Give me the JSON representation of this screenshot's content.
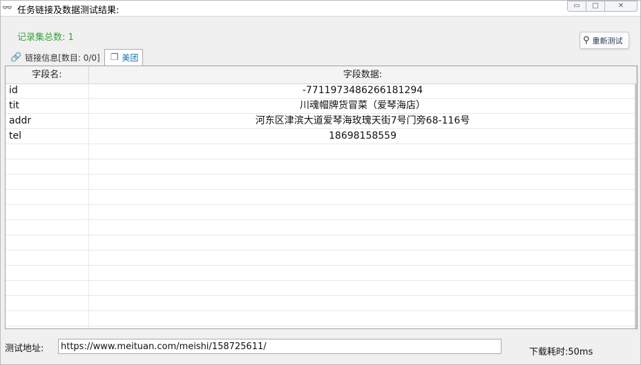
{
  "titlebar": {
    "title": "任务链接及数据测试结果:",
    "app_icon": "glasses-icon",
    "minimize_symbol": "▭",
    "restore_symbol": "□",
    "close_symbol": "✕"
  },
  "summary": {
    "record_count": "记录集总数: 1"
  },
  "toolbar": {
    "retest_label": "重新测试",
    "retest_icon": "search-icon"
  },
  "tabs": [
    {
      "label": "链接信息[数目: 0/0]",
      "icon": "link-icon",
      "active": false
    },
    {
      "label": "美团",
      "icon": "copy-icon",
      "active": true
    }
  ],
  "grid": {
    "columns": [
      "字段名:",
      "字段数据:"
    ],
    "rows": [
      {
        "name": "id",
        "value": "-7711973486266181294"
      },
      {
        "name": "tit",
        "value": "川魂帽牌货冒菜（爱琴海店）"
      },
      {
        "name": "addr",
        "value": "河东区津滨大道爱琴海玫瑰天街7号门旁68-116号"
      },
      {
        "name": "tel",
        "value": "18698158559"
      },
      {
        "name": "",
        "value": ""
      },
      {
        "name": "",
        "value": ""
      },
      {
        "name": "",
        "value": ""
      },
      {
        "name": "",
        "value": ""
      },
      {
        "name": "",
        "value": ""
      },
      {
        "name": "",
        "value": ""
      },
      {
        "name": "",
        "value": ""
      },
      {
        "name": "",
        "value": ""
      },
      {
        "name": "",
        "value": ""
      },
      {
        "name": "",
        "value": ""
      },
      {
        "name": "",
        "value": ""
      },
      {
        "name": "",
        "value": ""
      },
      {
        "name": "",
        "value": ""
      }
    ]
  },
  "footer": {
    "test_url_label": "测试地址:",
    "test_url_value": "https://www.meituan.com/meishi/158725611/",
    "download_time": "下载耗时:50ms"
  },
  "colors": {
    "record_count": "#36a33a",
    "active_tab": "#0c6fb8"
  }
}
